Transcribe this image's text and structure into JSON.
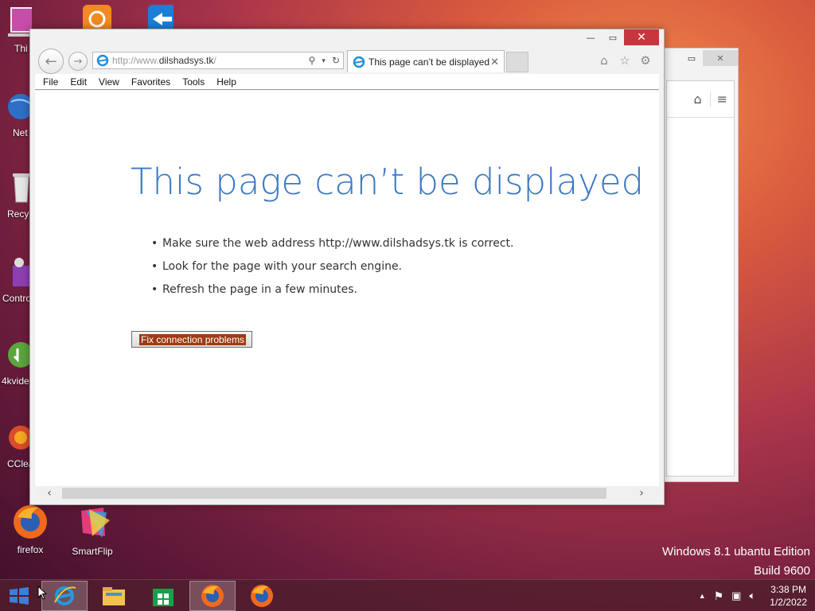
{
  "desktop": {
    "icons": [
      {
        "label": "Thi",
        "icon": "computer-icon"
      },
      {
        "label": "Net",
        "icon": "network-globe-icon"
      },
      {
        "label": "Recy",
        "icon": "recycle-bin-icon"
      },
      {
        "label": "Contro",
        "icon": "control-panel-icon"
      },
      {
        "label": "4kvide",
        "icon": "4k-video-downloader-icon"
      },
      {
        "label": "CClea",
        "icon": "ccleaner-icon"
      },
      {
        "label": "firefox",
        "icon": "firefox-icon"
      },
      {
        "label": "SmartFlip",
        "icon": "smartflip-icon"
      }
    ]
  },
  "ie": {
    "address": {
      "prefix": "http://www.",
      "host": "dilshadsys.tk",
      "suffix": "/"
    },
    "tab_title": "This page can’t be displayed",
    "menu": [
      "File",
      "Edit",
      "View",
      "Favorites",
      "Tools",
      "Help"
    ],
    "content": {
      "heading": "This page can’t be displayed",
      "bullets": [
        "Make sure the web address http://www.dilshadsys.tk is correct.",
        "Look for the page with your search engine.",
        "Refresh the page in a few minutes."
      ],
      "fix_button": "Fix connection problems"
    }
  },
  "watermark": {
    "line1": "Windows 8.1 ubantu Edition",
    "line2": "Build 9600"
  },
  "taskbar": {
    "apps": [
      "internet-explorer-icon",
      "file-explorer-icon",
      "store-icon",
      "firefox-icon",
      "firefox-icon"
    ],
    "time": "3:38 PM",
    "date": "1/2/2022"
  },
  "colors": {
    "heading_blue": "#3a78c3",
    "close_red": "#c7363d",
    "fix_highlight": "#9c3b14"
  }
}
